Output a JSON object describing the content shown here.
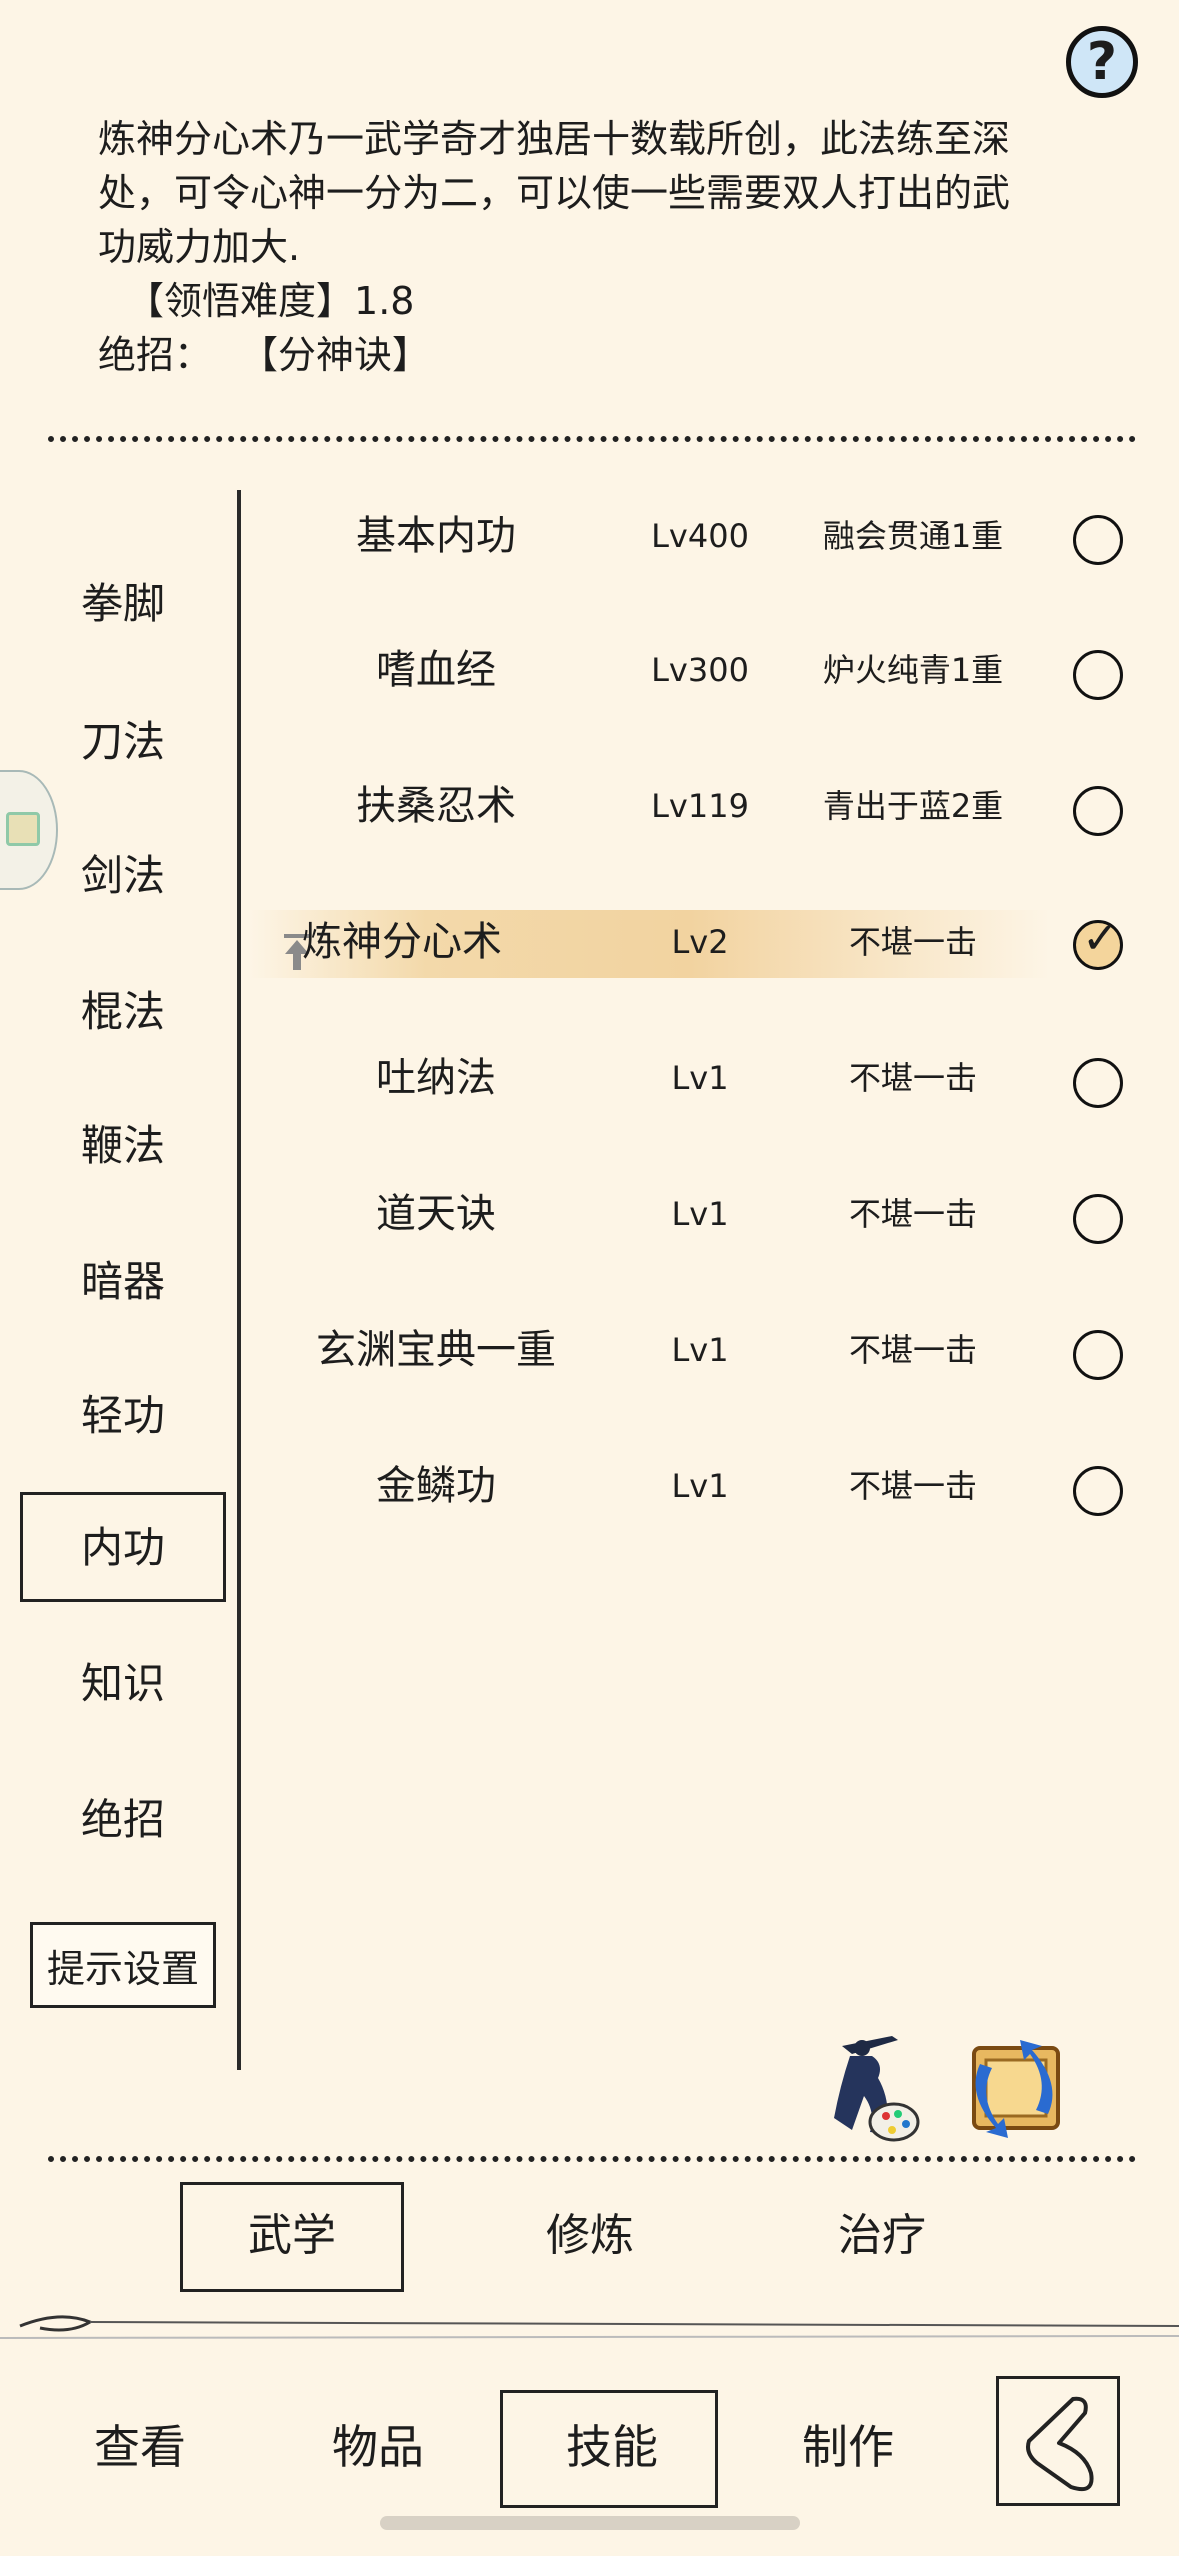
{
  "header": {
    "help_label": "?"
  },
  "description": {
    "lines": [
      "炼神分心术乃一武学奇才独居十数载所创，此法练至深",
      "处，可令心神一分为二，可以使一些需要双人打出的武",
      "功威力加大."
    ],
    "difficulty_label": "【领悟难度】",
    "difficulty_value": "1.8",
    "ultimate_label": "绝招：",
    "ultimate_value": "【分神诀】"
  },
  "categories": [
    {
      "label": "拳脚"
    },
    {
      "label": "刀法"
    },
    {
      "label": "剑法"
    },
    {
      "label": "棍法"
    },
    {
      "label": "鞭法"
    },
    {
      "label": "暗器"
    },
    {
      "label": "轻功"
    },
    {
      "label": "内功",
      "selected": true
    },
    {
      "label": "知识"
    },
    {
      "label": "绝招"
    }
  ],
  "hint_settings_label": "提示设置",
  "skills": [
    {
      "name": "基本内功",
      "level": "Lv400",
      "rank": "融会贯通1重",
      "checked": false
    },
    {
      "name": "嗜血经",
      "level": "Lv300",
      "rank": "炉火纯青1重",
      "checked": false
    },
    {
      "name": "扶桑忍术",
      "level": "Lv119",
      "rank": "青出于蓝2重",
      "checked": false
    },
    {
      "name": "炼神分心术",
      "level": "Lv2",
      "rank": "不堪一击",
      "checked": true,
      "highlighted": true
    },
    {
      "name": "吐纳法",
      "level": "Lv1",
      "rank": "不堪一击",
      "checked": false
    },
    {
      "name": "道天诀",
      "level": "Lv1",
      "rank": "不堪一击",
      "checked": false
    },
    {
      "name": "玄渊宝典一重",
      "level": "Lv1",
      "rank": "不堪一击",
      "checked": false
    },
    {
      "name": "金鳞功",
      "level": "Lv1",
      "rank": "不堪一击",
      "checked": false
    }
  ],
  "sub_tabs": [
    {
      "label": "武学",
      "selected": true
    },
    {
      "label": "修炼"
    },
    {
      "label": "治疗"
    }
  ],
  "bottom_nav": [
    {
      "label": "查看"
    },
    {
      "label": "物品"
    },
    {
      "label": "技能",
      "selected": true
    },
    {
      "label": "制作"
    }
  ],
  "icons": {
    "help": "question-icon",
    "promote": "up-arrow-icon",
    "martial_art_style": "swordsman-palette-icon",
    "swap": "swap-scroll-icon",
    "back": "back-arrow-icon",
    "side_tab": "side-tab-icon"
  },
  "colors": {
    "background": "#fdf5e6",
    "highlight": "#f2d3a0",
    "help_bg": "#cfe6f7"
  }
}
